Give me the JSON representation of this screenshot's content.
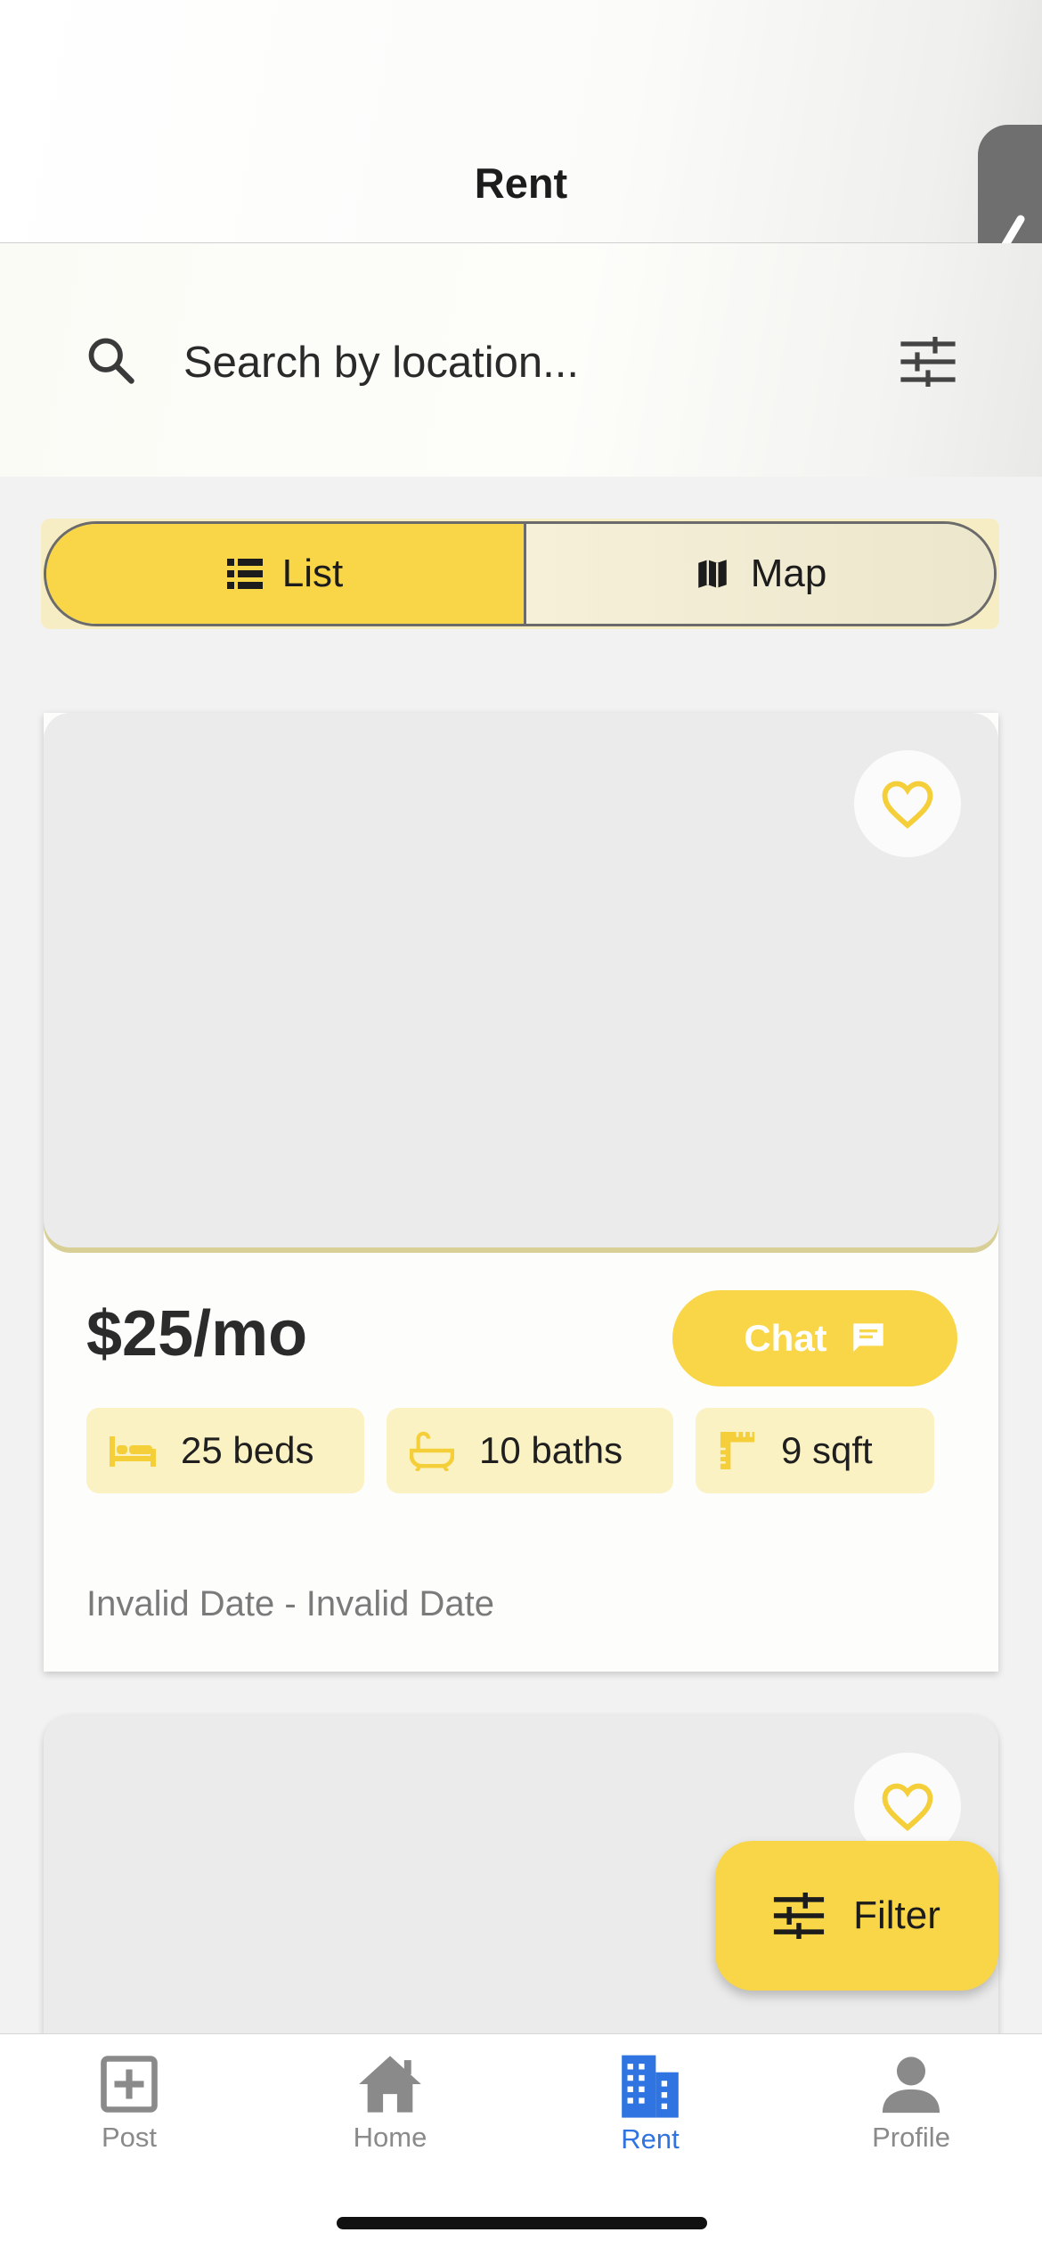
{
  "header": {
    "title": "Rent"
  },
  "search": {
    "placeholder": "Search by location...",
    "icon": "search-icon",
    "options_icon": "tune-icon"
  },
  "view_toggle": {
    "list_label": "List",
    "map_label": "Map",
    "selected": "List"
  },
  "listings": [
    {
      "price": "$25/mo",
      "chat_label": "Chat",
      "beds": "25 beds",
      "baths": "10 baths",
      "area": "9 sqft",
      "dates": "Invalid Date - Invalid Date"
    }
  ],
  "filter_button": {
    "label": "Filter"
  },
  "tabbar": {
    "items": [
      {
        "label": "Post",
        "icon": "add-box-icon"
      },
      {
        "label": "Home",
        "icon": "home-icon"
      },
      {
        "label": "Rent",
        "icon": "apartment-icon"
      },
      {
        "label": "Profile",
        "icon": "person-icon"
      }
    ],
    "active": "Rent"
  },
  "colors": {
    "accent": "#f8d648",
    "chip_bg": "#fbf2c4",
    "active_tab": "#2f74e0",
    "inactive_tab": "#8a8a8a"
  }
}
